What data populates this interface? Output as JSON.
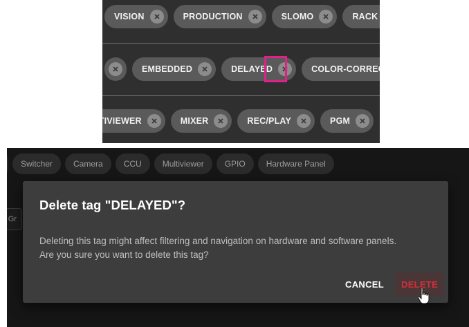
{
  "inset": {
    "row1": [
      "VISION",
      "PRODUCTION",
      "SLOMO",
      "RACK"
    ],
    "row2": [
      "",
      "EMBEDDED",
      "DELAYED",
      "COLOR-CORRECTED"
    ],
    "row3": [
      "MULTIVIEWER",
      "MIXER",
      "REC/PLAY",
      "PGM"
    ]
  },
  "filter_chips": [
    "Switcher",
    "Camera",
    "CCU",
    "Multiviewer",
    "GPIO",
    "Hardware Panel"
  ],
  "left_field_text": "r Gr",
  "dialog": {
    "title": "Delete tag \"DELAYED\"?",
    "body": "Deleting this tag might affect filtering and navigation on hardware and software panels. Are you sure you want to delete this tag?",
    "cancel_label": "CANCEL",
    "delete_label": "DELETE"
  },
  "colors": {
    "highlight": "#e0218a",
    "danger": "#d32f3a"
  }
}
